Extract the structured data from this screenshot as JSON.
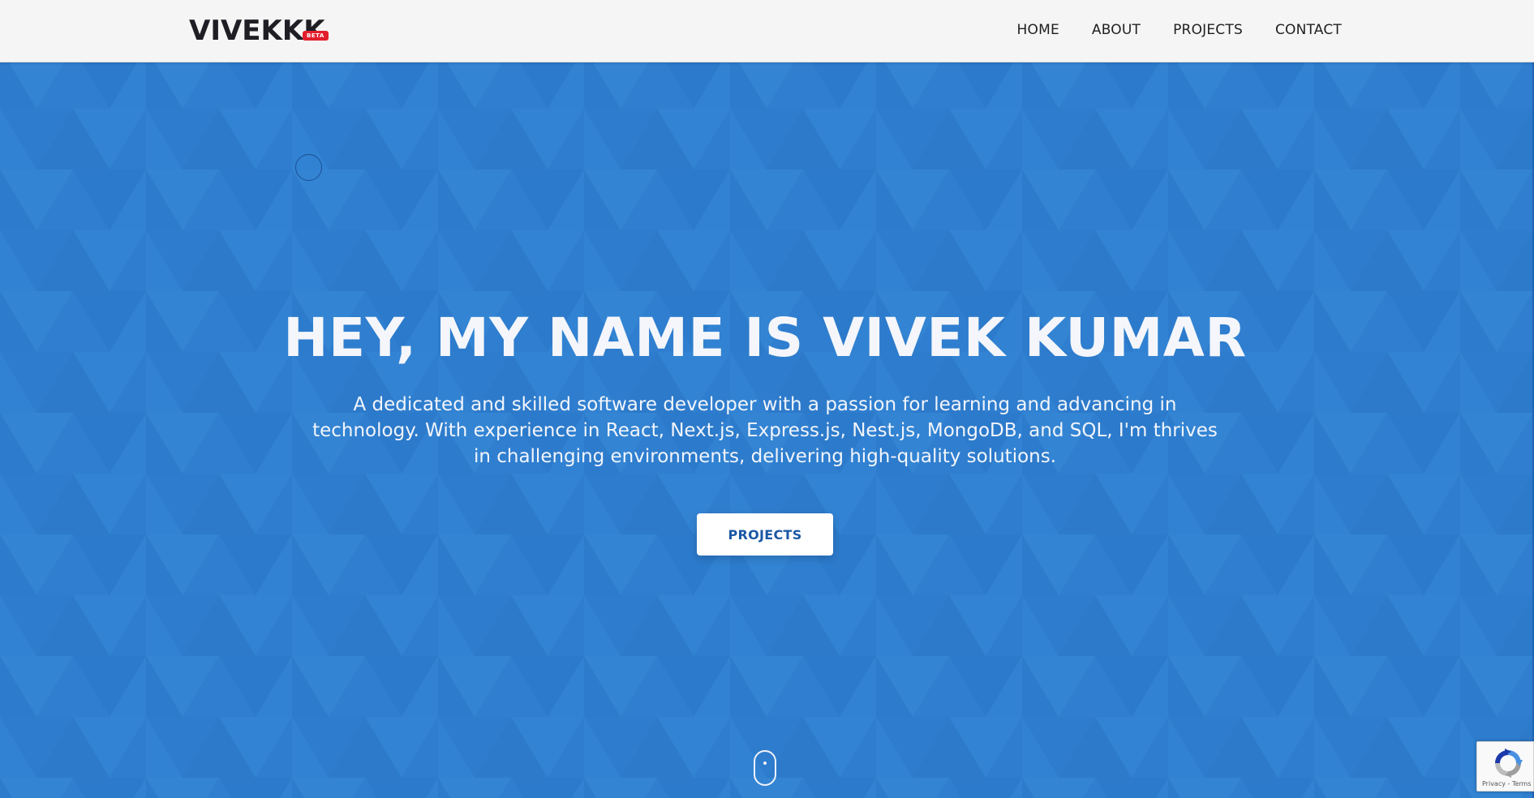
{
  "header": {
    "logo": "VIVEKKK",
    "badge": "BETA",
    "nav": [
      {
        "label": "HOME"
      },
      {
        "label": "ABOUT"
      },
      {
        "label": "PROJECTS"
      },
      {
        "label": "CONTACT"
      }
    ]
  },
  "hero": {
    "title": "HEY, MY NAME IS VIVEK KUMAR",
    "description": "A dedicated and skilled software developer with a passion for learning and advancing in technology. With experience in React, Next.js, Express.js, Nest.js, MongoDB, and SQL, I'm thrives in challenging environments, delivering high-quality solutions.",
    "cta_label": "PROJECTS"
  },
  "recaptcha": {
    "privacy": "Privacy",
    "separator": " - ",
    "terms": "Terms"
  },
  "icons": [
    "scroll-mouse-icon",
    "recaptcha-icon",
    "cursor-circle"
  ],
  "colors": {
    "hero_background": "#2f7fd0",
    "header_background": "#f5f5f5",
    "badge": "#e31e2c",
    "cta_text": "#1b58a5",
    "logo_text": "#1e1e24"
  }
}
